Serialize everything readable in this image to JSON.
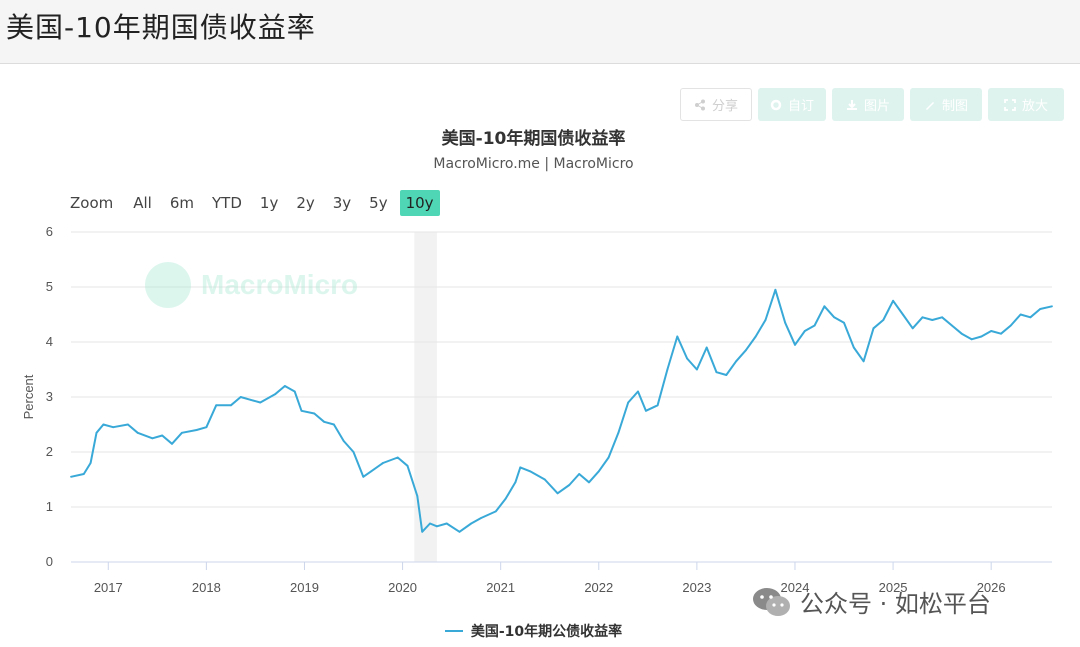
{
  "page": {
    "title": "美国-10年期国债收益率"
  },
  "toolbar": {
    "share_label": "分享",
    "custom_label": "自订",
    "image_label": "图片",
    "draw_label": "制图",
    "enlarge_label": "放大"
  },
  "range_selector": {
    "label": "Zoom",
    "buttons": [
      "All",
      "6m",
      "YTD",
      "1y",
      "2y",
      "3y",
      "5y",
      "10y"
    ],
    "selected": "10y"
  },
  "watermark": {
    "text": "MacroMicro"
  },
  "wechat": {
    "text": "公众号 · 如松平台"
  },
  "colors": {
    "series": "#39a9d8",
    "accent": "#4fd6b5",
    "recession": "#f2f2f2"
  },
  "chart_data": {
    "type": "line",
    "title": "美国-10年期国债收益率",
    "subtitle": "MacroMicro.me | MacroMicro",
    "ylabel": "Percent",
    "xlabel": "",
    "ylim": [
      0,
      6
    ],
    "y_ticks": [
      0,
      1,
      2,
      3,
      4,
      5,
      6
    ],
    "xlim": [
      2016.62,
      2026.62
    ],
    "x_ticks": [
      "2017",
      "2018",
      "2019",
      "2020",
      "2021",
      "2022",
      "2023",
      "2024",
      "2025",
      "2026"
    ],
    "grid": true,
    "legend": "bottom-center",
    "recession_band": [
      2020.12,
      2020.35
    ],
    "series": [
      {
        "name": "美国-10年期公债收益率",
        "points": [
          [
            2016.62,
            1.55
          ],
          [
            2016.75,
            1.6
          ],
          [
            2016.82,
            1.8
          ],
          [
            2016.88,
            2.35
          ],
          [
            2016.95,
            2.5
          ],
          [
            2017.05,
            2.45
          ],
          [
            2017.2,
            2.5
          ],
          [
            2017.3,
            2.35
          ],
          [
            2017.45,
            2.25
          ],
          [
            2017.55,
            2.3
          ],
          [
            2017.65,
            2.15
          ],
          [
            2017.75,
            2.35
          ],
          [
            2017.9,
            2.4
          ],
          [
            2018.0,
            2.45
          ],
          [
            2018.1,
            2.85
          ],
          [
            2018.25,
            2.85
          ],
          [
            2018.35,
            3.0
          ],
          [
            2018.45,
            2.95
          ],
          [
            2018.55,
            2.9
          ],
          [
            2018.7,
            3.05
          ],
          [
            2018.8,
            3.2
          ],
          [
            2018.9,
            3.1
          ],
          [
            2018.97,
            2.75
          ],
          [
            2019.1,
            2.7
          ],
          [
            2019.2,
            2.55
          ],
          [
            2019.3,
            2.5
          ],
          [
            2019.4,
            2.2
          ],
          [
            2019.5,
            2.0
          ],
          [
            2019.6,
            1.55
          ],
          [
            2019.68,
            1.65
          ],
          [
            2019.8,
            1.8
          ],
          [
            2019.95,
            1.9
          ],
          [
            2020.05,
            1.75
          ],
          [
            2020.15,
            1.2
          ],
          [
            2020.2,
            0.55
          ],
          [
            2020.28,
            0.7
          ],
          [
            2020.35,
            0.65
          ],
          [
            2020.45,
            0.7
          ],
          [
            2020.58,
            0.55
          ],
          [
            2020.7,
            0.7
          ],
          [
            2020.8,
            0.8
          ],
          [
            2020.95,
            0.92
          ],
          [
            2021.05,
            1.15
          ],
          [
            2021.15,
            1.45
          ],
          [
            2021.2,
            1.72
          ],
          [
            2021.3,
            1.65
          ],
          [
            2021.45,
            1.5
          ],
          [
            2021.58,
            1.25
          ],
          [
            2021.7,
            1.4
          ],
          [
            2021.8,
            1.6
          ],
          [
            2021.9,
            1.45
          ],
          [
            2022.0,
            1.65
          ],
          [
            2022.1,
            1.9
          ],
          [
            2022.2,
            2.35
          ],
          [
            2022.3,
            2.9
          ],
          [
            2022.4,
            3.1
          ],
          [
            2022.48,
            2.75
          ],
          [
            2022.6,
            2.85
          ],
          [
            2022.7,
            3.5
          ],
          [
            2022.8,
            4.1
          ],
          [
            2022.9,
            3.7
          ],
          [
            2023.0,
            3.5
          ],
          [
            2023.1,
            3.9
          ],
          [
            2023.2,
            3.45
          ],
          [
            2023.3,
            3.4
          ],
          [
            2023.4,
            3.65
          ],
          [
            2023.5,
            3.85
          ],
          [
            2023.6,
            4.1
          ],
          [
            2023.7,
            4.4
          ],
          [
            2023.8,
            4.95
          ],
          [
            2023.9,
            4.35
          ],
          [
            2024.0,
            3.95
          ],
          [
            2024.1,
            4.2
          ],
          [
            2024.2,
            4.3
          ],
          [
            2024.3,
            4.65
          ],
          [
            2024.4,
            4.45
          ],
          [
            2024.5,
            4.35
          ],
          [
            2024.6,
            3.9
          ],
          [
            2024.7,
            3.65
          ],
          [
            2024.8,
            4.25
          ],
          [
            2024.9,
            4.4
          ],
          [
            2025.0,
            4.75
          ],
          [
            2025.1,
            4.5
          ],
          [
            2025.2,
            4.25
          ],
          [
            2025.3,
            4.45
          ],
          [
            2025.4,
            4.4
          ],
          [
            2025.5,
            4.45
          ],
          [
            2025.6,
            4.3
          ],
          [
            2025.7,
            4.15
          ],
          [
            2025.8,
            4.05
          ],
          [
            2025.9,
            4.1
          ],
          [
            2026.0,
            4.2
          ],
          [
            2026.1,
            4.15
          ],
          [
            2026.2,
            4.3
          ],
          [
            2026.3,
            4.5
          ],
          [
            2026.4,
            4.45
          ],
          [
            2026.5,
            4.6
          ],
          [
            2026.62,
            4.65
          ]
        ]
      }
    ]
  }
}
